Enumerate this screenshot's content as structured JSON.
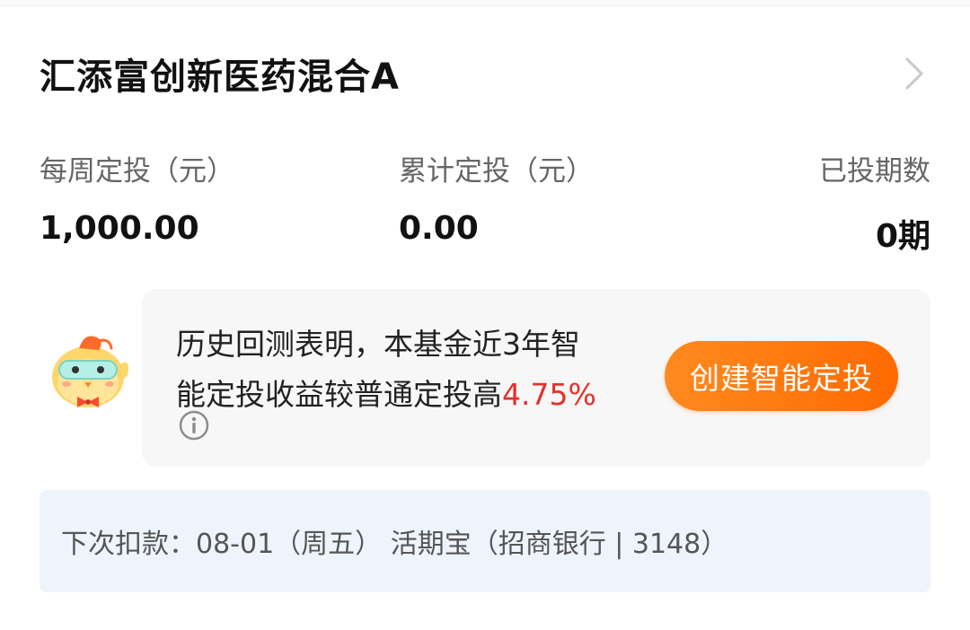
{
  "fund": {
    "name": "汇添富创新医药混合A"
  },
  "stats": {
    "weekly_label": "每周定投（元）",
    "weekly_value": "1,000.00",
    "total_label": "累计定投（元）",
    "total_value": "0.00",
    "periods_label": "已投期数",
    "periods_value": "0期"
  },
  "smart_card": {
    "text_line1": "历史回测表明，本基金近3年智",
    "text_line2_prefix": "能定投收益较普通定投高",
    "highlight_value": "4.75%",
    "button_label": "创建智能定投",
    "accent_color": "#ff7a00",
    "highlight_color": "#e5302a"
  },
  "deduction": {
    "text": "下次扣款：08-01（周五） 活期宝（招商银行 | 3148）"
  },
  "icons": {
    "chevron": "chevron-right-icon",
    "info": "info-icon",
    "mascot": "mascot-chick-icon"
  }
}
